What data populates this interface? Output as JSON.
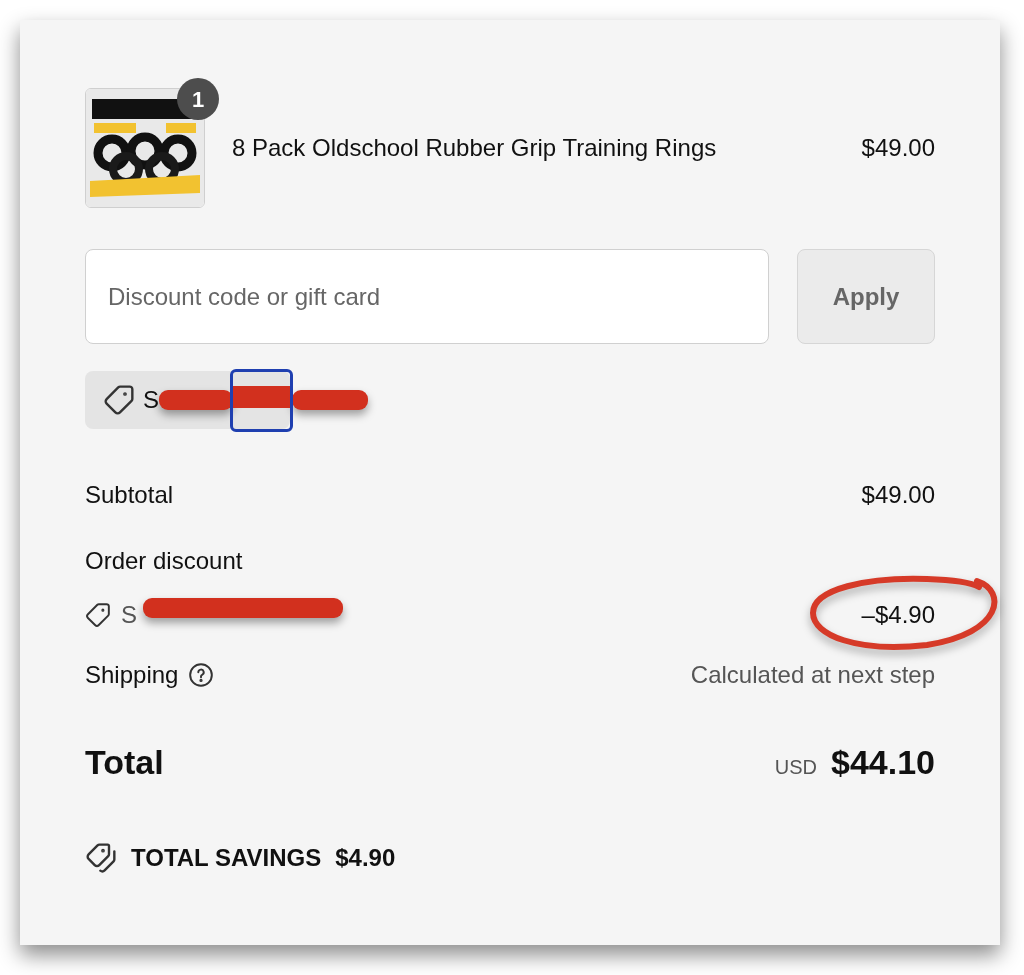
{
  "product": {
    "name": "8 Pack Oldschool Rubber Grip Training Rings",
    "price": "$49.00",
    "quantity": "1"
  },
  "discount": {
    "placeholder": "Discount code or gift card",
    "button": "Apply",
    "applied_code": "S"
  },
  "subtotal": {
    "label": "Subtotal",
    "value": "$49.00"
  },
  "order_discount": {
    "label": "Order discount",
    "code": "S",
    "value": "–$4.90"
  },
  "shipping": {
    "label": "Shipping",
    "value": "Calculated at next step"
  },
  "total": {
    "label": "Total",
    "currency": "USD",
    "value": "$44.10"
  },
  "savings": {
    "label": "TOTAL SAVINGS",
    "value": "$4.90"
  }
}
